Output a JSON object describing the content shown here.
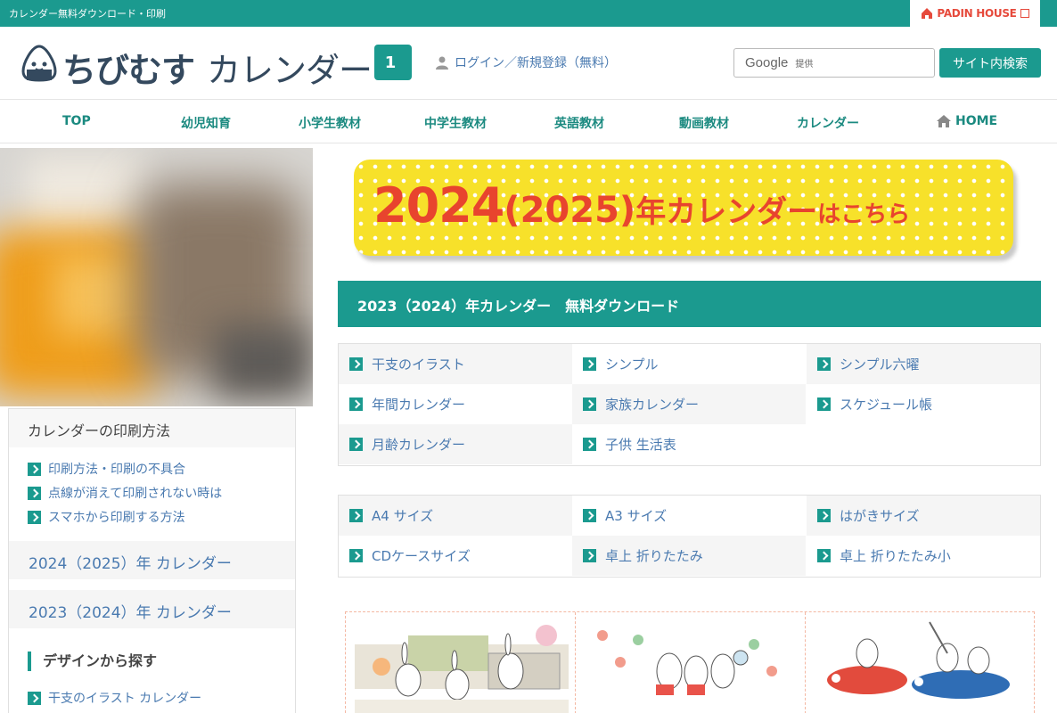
{
  "topbar": {
    "title": "カレンダー無料ダウンロード・印刷",
    "padin": "PADIN HOUSE"
  },
  "header": {
    "logo_a": "ちびむす",
    "logo_b": "カレンダー",
    "logo_num": "1",
    "login": "ログイン／新規登録（無料）",
    "search_google": "Google",
    "search_provided": "提供",
    "search_button": "サイト内検索"
  },
  "nav": {
    "items": [
      "TOP",
      "幼児知育",
      "小学生教材",
      "中学生教材",
      "英語教材",
      "動画教材",
      "カレンダー",
      "HOME"
    ]
  },
  "sidebar": {
    "print_title": "カレンダーの印刷方法",
    "print_links": [
      "印刷方法・印刷の不具合",
      "点線が消えて印刷されない時は",
      "スマホから印刷する方法"
    ],
    "year_2024": "2024（2025）年 カレンダー",
    "year_2023": "2023（2024）年 カレンダー",
    "design_title": "デザインから探す",
    "design_links": [
      "干支のイラスト カレンダー"
    ]
  },
  "banner": {
    "year": "2024",
    "paren": "(2025)",
    "nen": "年カレンダー",
    "kochira": "はこちら"
  },
  "download_title": "2023（2024）年カレンダー　無料ダウンロード",
  "grid1": [
    "干支のイラスト",
    "シンプル",
    "シンプル六曜",
    "年間カレンダー",
    "家族カレンダー",
    "スケジュール帳",
    "月齢カレンダー",
    "子供 生活表"
  ],
  "grid2": [
    "A4 サイズ",
    "A3 サイズ",
    "はがきサイズ",
    "CDケースサイズ",
    "卓上 折りたたみ",
    "卓上 折りたたみ小"
  ],
  "colors": {
    "teal": "#1b9a8f",
    "link": "#4a7ab0",
    "banner_yellow": "#f7e12a",
    "banner_red": "#e8442e"
  }
}
